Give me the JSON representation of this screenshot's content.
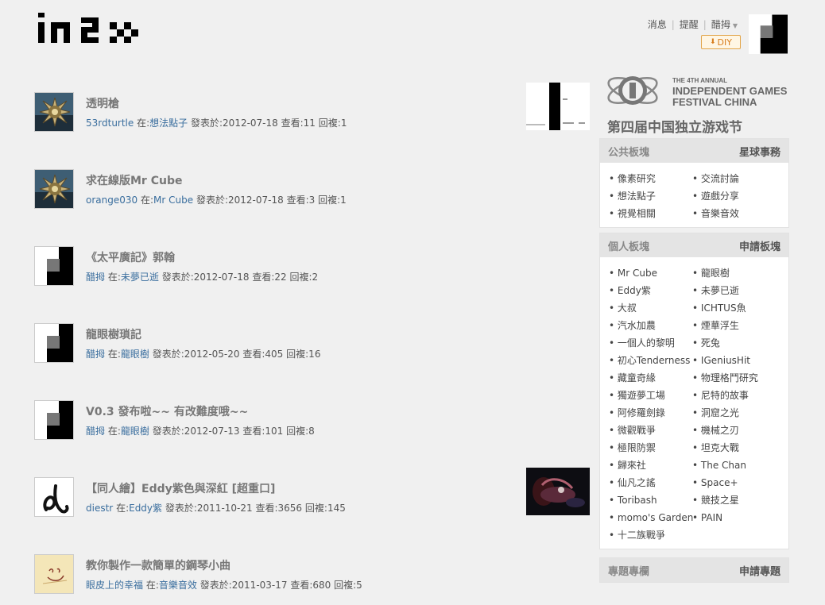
{
  "topnav": {
    "messages": "消息",
    "reminders": "提醒",
    "user": "醋拇",
    "diy": "DIY"
  },
  "posts": [
    {
      "title": "透明槍",
      "author": "53rdturtle",
      "board_prefix": "在:",
      "board": "想法點子",
      "date": "發表於:2012-07-18",
      "views": "查看:11",
      "replies": "回複:1",
      "avatar": "spiky-ball"
    },
    {
      "title": "求在線版Mr Cube",
      "author": "orange030",
      "board_prefix": "在:",
      "board": "Mr Cube",
      "date": "發表於:2012-07-18",
      "views": "查看:3",
      "replies": "回複:1",
      "avatar": "spiky-ball"
    },
    {
      "title": "《太平廣記》郭翰",
      "author": "醋拇",
      "board_prefix": "在:",
      "board": "未夢已逝",
      "date": "發表於:2012-07-18",
      "views": "查看:22",
      "replies": "回複:2",
      "avatar": "block"
    },
    {
      "title": "龍眼樹瑣記",
      "author": "醋拇",
      "board_prefix": "在:",
      "board": "龍眼樹",
      "date": "發表於:2012-05-20",
      "views": "查看:405",
      "replies": "回複:16",
      "avatar": "block"
    },
    {
      "title": "V0.3 發布啦~~ 有改難度哦~~",
      "author": "醋拇",
      "board_prefix": "在:",
      "board": "龍眼樹",
      "date": "發表於:2012-07-13",
      "views": "查看:101",
      "replies": "回複:8",
      "avatar": "block"
    },
    {
      "title": "【同人繪】Eddy紫色與深紅 [超重口]",
      "author": "diestr",
      "board_prefix": "在:",
      "board": "Eddy紫",
      "date": "發表於:2011-10-21",
      "views": "查看:3656",
      "replies": "回複:145",
      "avatar": "scribble"
    },
    {
      "title": "教你製作一款簡單的鋼琴小曲",
      "author": "眼皮上的幸福",
      "board_prefix": "在:",
      "board": "音樂音效",
      "date": "發表於:2011-03-17",
      "views": "查看:680",
      "replies": "回複:5",
      "avatar": "sketch"
    }
  ],
  "banner": {
    "line1": "THE 4TH ANNUAL",
    "line2": "INDEPENDENT GAMES",
    "line3": "FESTIVAL CHINA",
    "line4": "第四届中国独立游戏节"
  },
  "public_boards": {
    "heading": "公共板塊",
    "action": "星球事務",
    "items": [
      "像素研究",
      "交流討論",
      "想法點子",
      "遊戲分享",
      "視覺相關",
      "音樂音效"
    ]
  },
  "personal_boards": {
    "heading": "個人板塊",
    "action": "申請板塊",
    "items": [
      "Mr Cube",
      "龍眼樹",
      "Eddy紫",
      "未夢已逝",
      "大叔",
      "ICHTUS魚",
      "汽水加農",
      "煙華浮生",
      "一個人的黎明",
      "死兔",
      "初心Tenderness",
      "IGeniusHit",
      "藏童奇緣",
      "物理格鬥研究",
      "獨遊夢工場",
      "尼特的故事",
      "阿修羅劍錄",
      "洞窟之光",
      "微觀戰爭",
      "機械之刃",
      "極限防禦",
      "坦克大戰",
      "歸來社",
      "The Chan",
      "仙凡之謠",
      "Space+",
      "Toribash",
      "競技之星",
      "momo's Garden",
      "PAIN",
      "十二族戰爭"
    ]
  },
  "columns": {
    "heading": "專題專欄",
    "action": "申請專題"
  }
}
